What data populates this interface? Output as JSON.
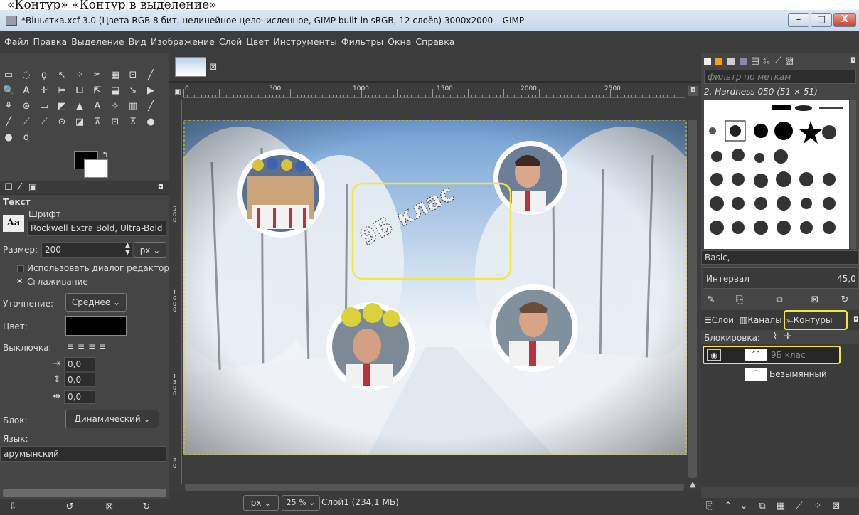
{
  "caption": "«Контур» «Контур в выделение»",
  "window": {
    "title": "*Віньєтка.xcf-3.0 (Цвета RGB 8 бит, нелинейное целочисленное, GIMP built-in sRGB, 12 слоёв) 3000x2000 – GIMP",
    "minimize": "–",
    "maximize": "□",
    "close": "X"
  },
  "menu": [
    "Файл",
    "Правка",
    "Выделение",
    "Вид",
    "Изображение",
    "Слой",
    "Цвет",
    "Инструменты",
    "Фильтры",
    "Окна",
    "Справка"
  ],
  "toolbox": {
    "rows": [
      [
        "▭",
        "◌",
        "ϙ",
        "↖",
        "⁘",
        "✂",
        "▦",
        "⊡",
        "╱"
      ],
      [
        "🔍",
        "A",
        "✛",
        "⊨",
        "⧠",
        "⇱",
        "⬓",
        "↘",
        "▶"
      ],
      [
        "⚘",
        "⊛",
        "▭",
        "◩",
        "▲",
        "A",
        "✧",
        "▥",
        "╱"
      ],
      [
        "╱",
        "⟋",
        "⟋",
        "⊙",
        "◪",
        "⊼",
        "⊡",
        "⊼",
        "●"
      ],
      [
        "●",
        "ɖ"
      ]
    ]
  },
  "tool_options": {
    "tab_icons": [
      "☐",
      "⁄",
      "▣"
    ],
    "title": "Текст",
    "font_label": "Шрифт",
    "font_icon": "Aa",
    "font_value": "Rockwell Extra Bold, Ultra-Bold",
    "size_label": "Размер:",
    "size_value": "200",
    "size_unit": "px",
    "use_editor": "Использовать диалог редактора",
    "antialias": "Сглаживание",
    "hinting_label": "Уточнение:",
    "hinting_value": "Среднее",
    "color_label": "Цвет:",
    "color_value": "#000000",
    "justify_label": "Выключка:",
    "indent_value": "0,0",
    "line_spacing_value": "0,0",
    "letter_spacing_value": "0,0",
    "box_label": "Блок:",
    "box_value": "Динамический",
    "lang_label": "Язык:",
    "lang_value": "арумынский"
  },
  "canvas": {
    "image_tab_close": "⊠",
    "ruler_labels": [
      "0",
      "500",
      "1000",
      "1500",
      "2000",
      "2500"
    ],
    "vruler_labels": [
      "5 0 0",
      "1 0 0 0",
      "1 5 0 0",
      "2 0"
    ],
    "text_overlay": "9Б клас"
  },
  "statusbar": {
    "unit": "px",
    "zoom": "25 %",
    "info": "Слой1 (234,1 МБ)"
  },
  "right_panel": {
    "filter_placeholder": "фильтр по меткам",
    "brush_name": "2. Hardness 050 (51 × 51)",
    "preset": "Basic,",
    "spacing_label": "Интервал",
    "spacing_value": "45,0",
    "tabs": [
      "Слои",
      "Каналы",
      "Контуры"
    ],
    "lock_label": "Блокировка:",
    "paths": [
      "9Б клас",
      "Безымянный"
    ]
  },
  "colors": {
    "accent_highlight": "#f3e83a",
    "panel_bg": "#454545",
    "window_bg": "#3c3c3c"
  }
}
